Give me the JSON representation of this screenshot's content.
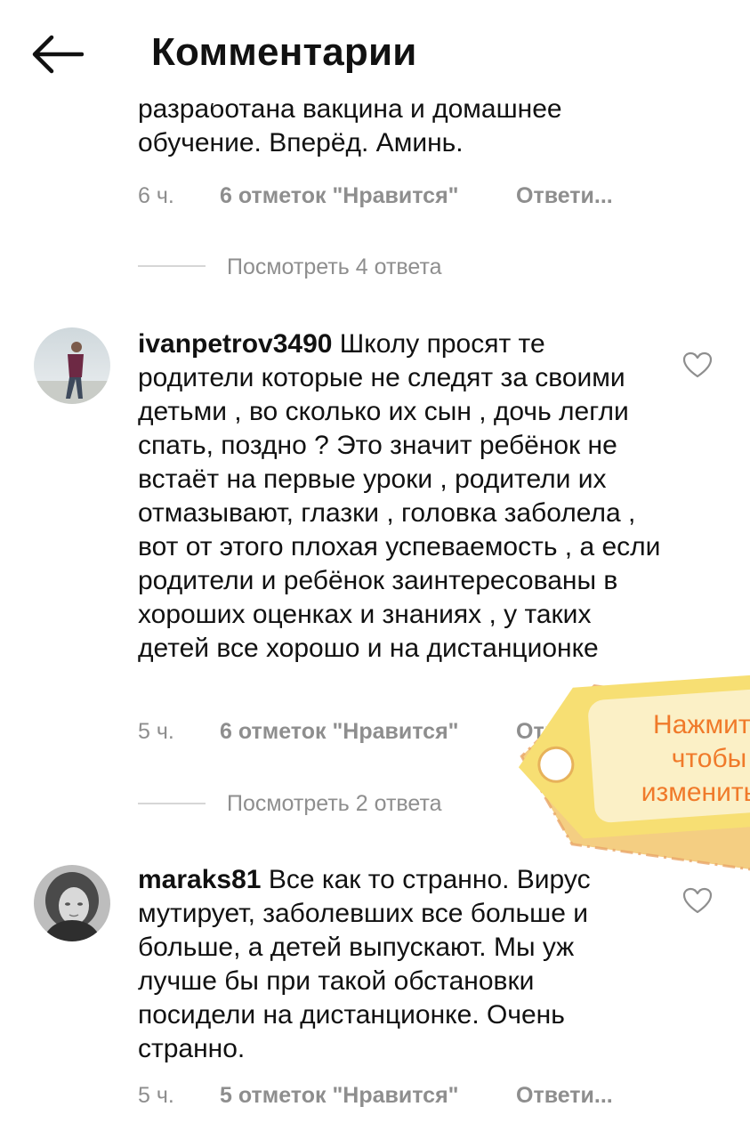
{
  "header": {
    "title": "Комментарии",
    "back_icon": "arrow-left-icon"
  },
  "comments": [
    {
      "text_partial_line1": "разработана вакцина и домашнее",
      "text_partial_line2": "обучение. Вперёд. Аминь.",
      "time": "6 ч.",
      "likes": "6 отметок \"Нравится\"",
      "reply": "Ответи...",
      "view_replies": "Посмотреть 4 ответа"
    },
    {
      "username": "ivanpetrov3490",
      "text": "Школу просят те родители которые не следят за своими детьми , во сколько их сын , дочь легли спать, поздно ? Это значит ребёнок не встаёт на первые уроки , родители их отмазывают, глазки , головка заболела , вот от этого плохая успеваемость , а если родители и ребёнок заинтересованы в хороших оценках и знаниях , у таких детей все хорошо и на дистанционке",
      "time": "5 ч.",
      "likes": "6 отметок \"Нравится\"",
      "reply": "Ответи...",
      "view_replies": "Посмотреть 2 ответа"
    },
    {
      "username": "maraks81",
      "text": "Все как то странно. Вирус мутирует, заболевших все больше и больше, а детей выпускают. Мы уж лучше бы при такой обстановки посидели на дистанционке. Очень странно.",
      "time": "5 ч.",
      "likes": "5 отметок \"Нравится\"",
      "reply": "Ответи..."
    }
  ],
  "overlay_tag": {
    "line1": "Нажмите",
    "line2": "чтобы",
    "line3": "изменить т",
    "color": "#f7df73",
    "text_color": "#f07a2a"
  },
  "colors": {
    "meta": "#8e8e8e",
    "text": "#111111",
    "divider": "#d6d6d6"
  }
}
